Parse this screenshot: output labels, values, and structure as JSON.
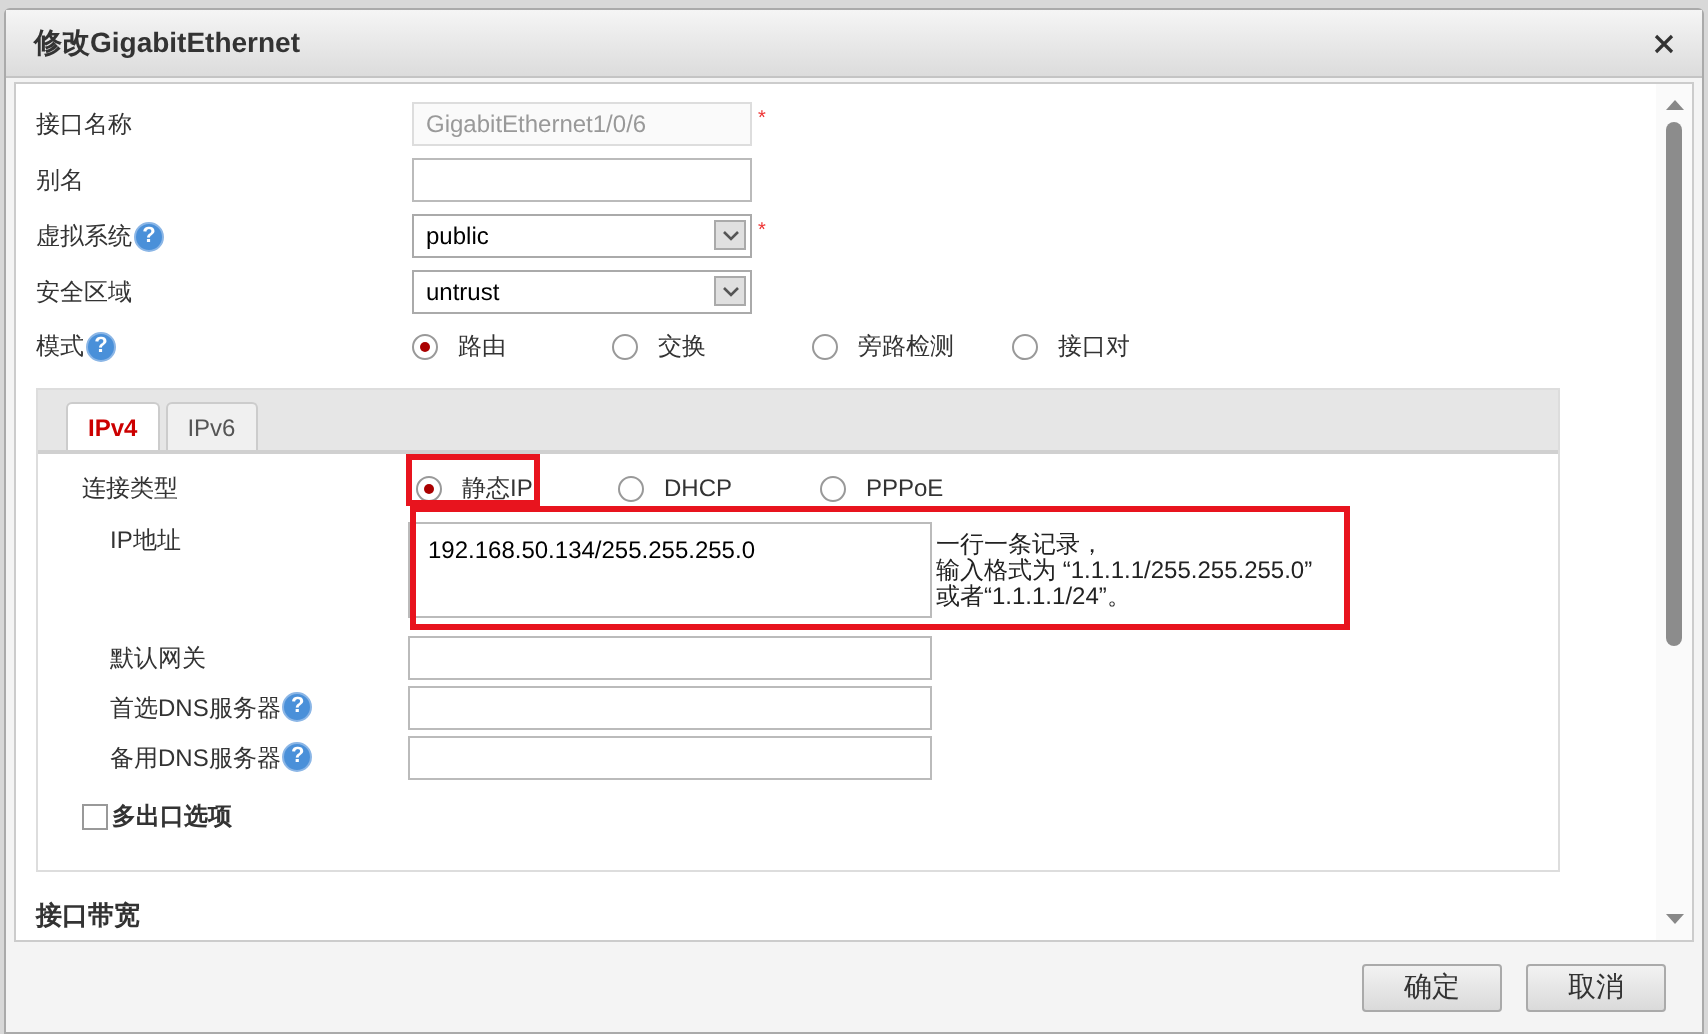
{
  "dialog": {
    "title": "修改GigabitEthernet"
  },
  "fields": [
    {
      "kind": "input",
      "label": "接口名称",
      "value": "GigabitEthernet1/0/6",
      "disabled": true,
      "required_mark": "*"
    },
    {
      "kind": "input",
      "label": "别名",
      "disabled": false
    },
    {
      "kind": "select",
      "label": "虚拟系统",
      "value": "public",
      "disabled": false,
      "required_mark": "*",
      "help": "?"
    },
    {
      "kind": "select",
      "label": "安全区域",
      "value": "untrust",
      "disabled": false
    }
  ],
  "mode": {
    "label": "模式",
    "help": "?",
    "options": [
      {
        "label": "路由",
        "selected": true
      },
      {
        "label": "交换",
        "selected": false
      },
      {
        "label": "旁路检测",
        "selected": false
      },
      {
        "label": "接口对",
        "selected": false
      }
    ]
  },
  "tabs": [
    {
      "label": "IPv4",
      "selected": true
    },
    {
      "label": "IPv6",
      "selected": false
    }
  ],
  "connection": {
    "label": "连接类型",
    "options": [
      {
        "label": "静态IP",
        "selected": true
      },
      {
        "label": "DHCP",
        "selected": false
      },
      {
        "label": "PPPoE",
        "selected": false
      }
    ]
  },
  "ip_address": {
    "label": "IP地址",
    "value": "192.168.50.134/255.255.255.0",
    "hint": [
      "一行一条记录，",
      "输入格式为 “1.1.1.1/255.255.255.0”",
      "或者“1.1.1.1/24”。"
    ]
  },
  "ipv4_fields": [
    {
      "label": "默认网关"
    },
    {
      "label": "首选DNS服务器",
      "help": "?"
    },
    {
      "label": "备用DNS服务器",
      "help": "?"
    }
  ],
  "multi_exit": {
    "label": "多出口选项",
    "checked": false
  },
  "section": {
    "title": "接口带宽"
  },
  "buttons": [
    "确定",
    "取消"
  ]
}
